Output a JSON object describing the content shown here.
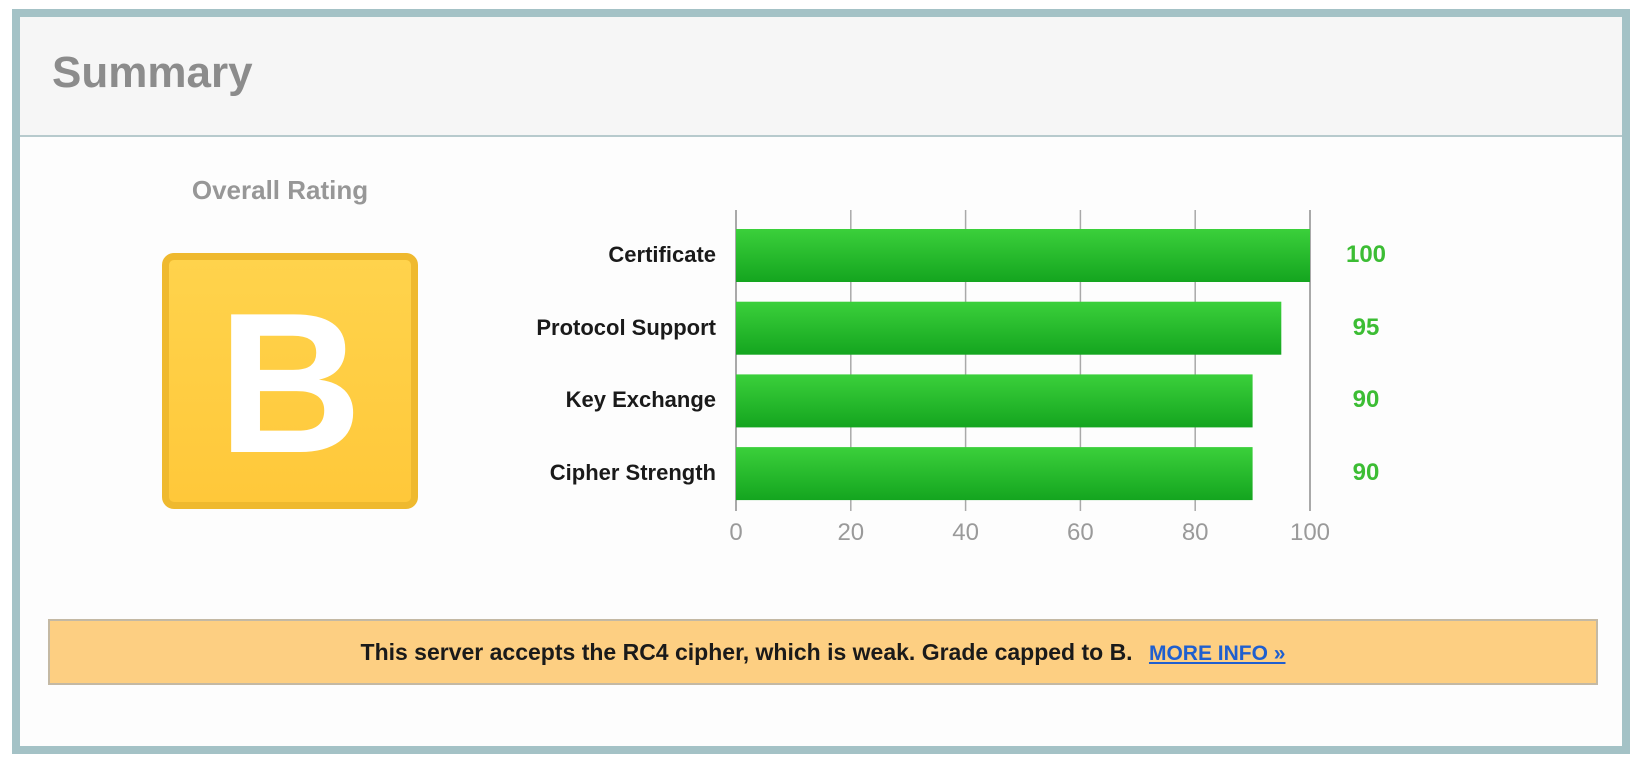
{
  "page": {
    "title": "Summary"
  },
  "rating": {
    "title": "Overall Rating",
    "grade": "B",
    "grade_color": "#ffcc3e",
    "grade_border_color": "#efb92e"
  },
  "chart_data": {
    "type": "bar",
    "orientation": "horizontal",
    "categories": [
      "Certificate",
      "Protocol Support",
      "Key Exchange",
      "Cipher Strength"
    ],
    "values": [
      100,
      95,
      90,
      90
    ],
    "value_labels": [
      "100",
      "95",
      "90",
      "90"
    ],
    "xlim": [
      0,
      100
    ],
    "x_ticks": [
      0,
      20,
      40,
      60,
      80,
      100
    ],
    "x_tick_labels": [
      "0",
      "20",
      "40",
      "60",
      "80",
      "100"
    ],
    "bar_color": "#22b92b",
    "value_color": "#3cbd34",
    "grid": true
  },
  "banner": {
    "message": "This server accepts the RC4 cipher, which is weak. Grade capped to B.",
    "link_label": "MORE INFO »",
    "background_color": "#fdcf82",
    "link_color": "#1f5fcf"
  }
}
